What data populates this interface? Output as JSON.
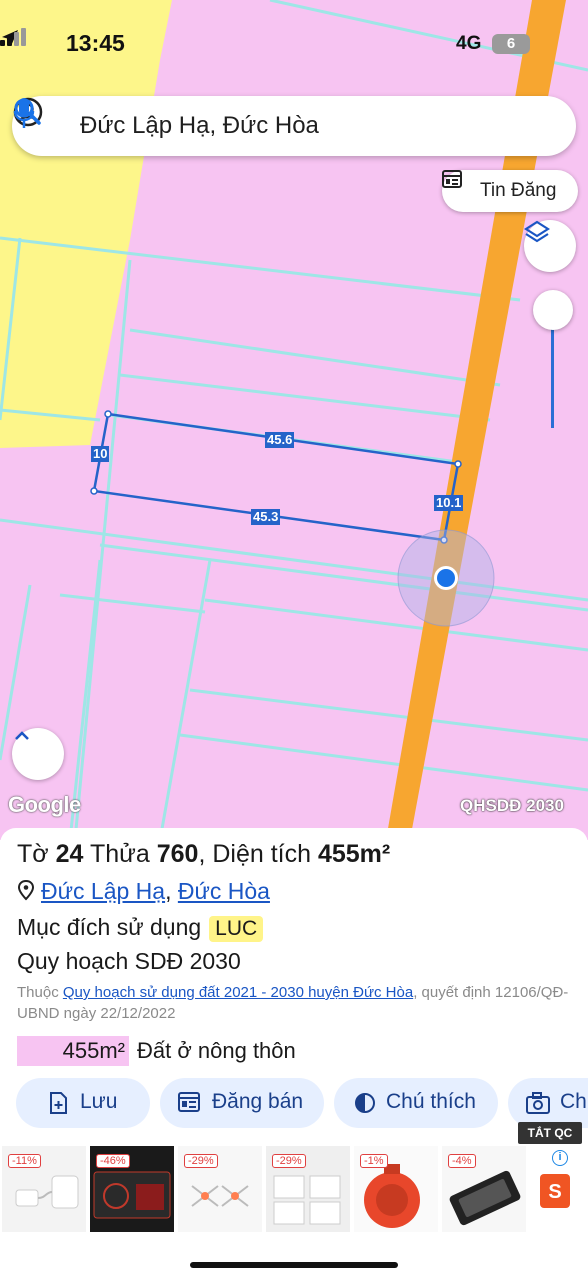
{
  "status_bar": {
    "time": "13:45",
    "network": "4G",
    "battery": "6"
  },
  "search": {
    "query": "Đức Lập Hạ, Đức Hòa"
  },
  "map": {
    "tin_dang_label": "Tin Đăng",
    "dimensions": {
      "top": "45.6",
      "left": "10",
      "bottom": "45.3",
      "right": "10.1"
    },
    "google_logo": "Google",
    "layer_name": "QHSDĐ 2030",
    "colors": {
      "residential": "#f7c4f2",
      "agricultural": "#fdf68a",
      "road": "#f7a630",
      "parcel_outline": "#2563c9",
      "parcel_lines": "#9ee6e6"
    }
  },
  "details": {
    "to_label": "Tờ",
    "to_value": "24",
    "thua_label": "Thửa",
    "thua_value": "760",
    "area_label": ", Diện tích",
    "area_value": "455m²",
    "address_part1": "Đức Lập Hạ",
    "address_sep": ",",
    "address_part2": "Đức Hòa",
    "purpose_label": "Mục đích sử dụng",
    "purpose_code": "LUC",
    "plan_title": "Quy hoạch SDĐ 2030",
    "note_prefix": "Thuộc",
    "note_link": "Quy hoạch sử dụng đất 2021 - 2030 huyện Đức Hòa",
    "note_suffix": ", quyết định 12106/QĐ-UBND ngày 22/12/2022",
    "zone_area": "455m²",
    "zone_type": "Đất ở nông thôn"
  },
  "actions": [
    "Lưu",
    "Đăng bán",
    "Chú thích",
    "Ch"
  ],
  "ads": {
    "close_label": "TẮT QC",
    "discounts": [
      "-11%",
      "-46%",
      "-29%",
      "-29%",
      "-1%",
      "-4%"
    ],
    "info_icon": "i",
    "shopee": "S"
  }
}
